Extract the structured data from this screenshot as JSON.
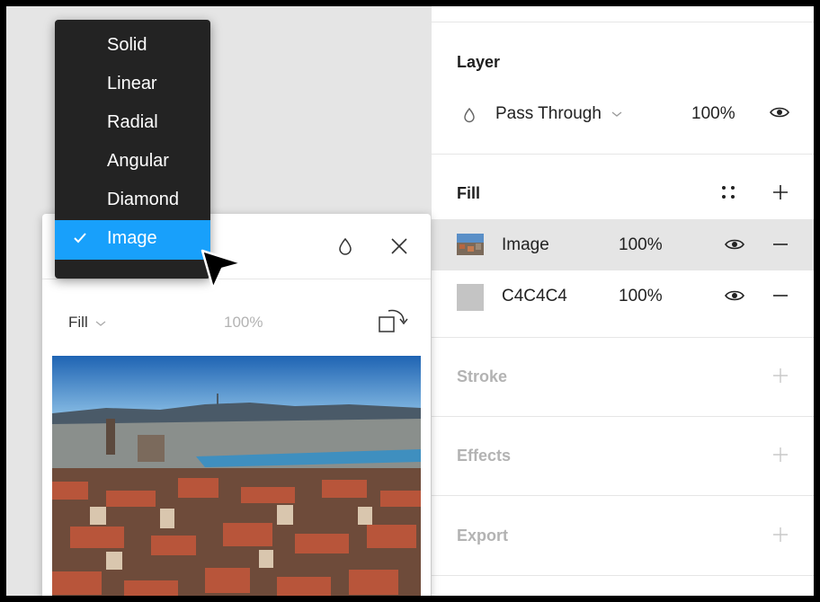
{
  "layer": {
    "title": "Layer",
    "blend_mode": "Pass Through",
    "opacity": "100%"
  },
  "fill": {
    "title": "Fill",
    "rows": [
      {
        "name": "Image",
        "opacity": "100%"
      },
      {
        "name": "C4C4C4",
        "opacity": "100%",
        "swatch_color": "#c4c4c4"
      }
    ]
  },
  "stroke": {
    "title": "Stroke"
  },
  "effects": {
    "title": "Effects"
  },
  "export": {
    "title": "Export"
  },
  "popup": {
    "fill_mode": "Fill",
    "opacity": "100%"
  },
  "menu": {
    "items": [
      "Solid",
      "Linear",
      "Radial",
      "Angular",
      "Diamond",
      "Image"
    ],
    "selected": "Image"
  },
  "colors": {
    "accent": "#18a0fb",
    "menu_bg": "#232323",
    "canvas_bg": "#e5e5e5"
  }
}
